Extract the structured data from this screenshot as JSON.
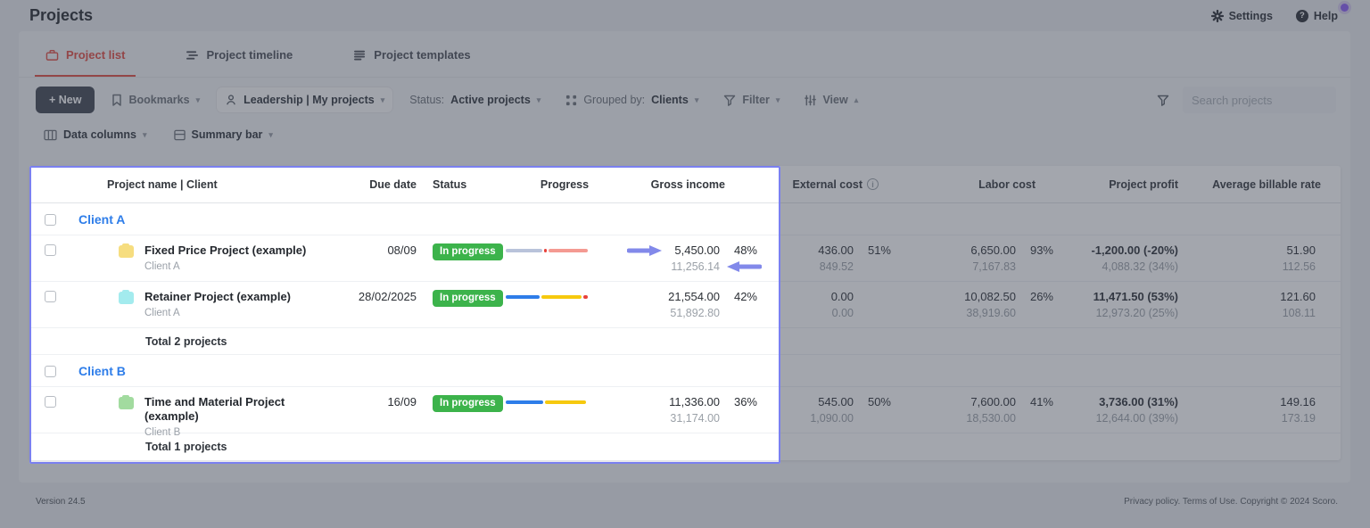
{
  "theme": {
    "accent_red": "#e14b41",
    "link_blue": "#2e7de9",
    "badge_green": "#3cb34b",
    "annotation": "#8289ea",
    "spotlight_border": "#7a80f0"
  },
  "header": {
    "title": "Projects",
    "settings": "Settings",
    "help": "Help"
  },
  "tabs": [
    {
      "label": "Project list"
    },
    {
      "label": "Project timeline"
    },
    {
      "label": "Project templates"
    }
  ],
  "toolbar": {
    "new_label": "+ New",
    "bookmarks_label": "Bookmarks",
    "scope_label": "Leadership | My projects",
    "status_prefix": "Status:",
    "status_value": "Active projects",
    "grouped_prefix": "Grouped by:",
    "grouped_value": "Clients",
    "filter_label": "Filter",
    "view_label": "View",
    "data_columns_label": "Data columns",
    "summary_bar_label": "Summary bar",
    "search_placeholder": "Search projects"
  },
  "table": {
    "columns": [
      "Project name | Client",
      "Due date",
      "Status",
      "Progress",
      "Gross income",
      "External cost",
      "Labor cost",
      "Project profit",
      "Average billable rate"
    ],
    "groups": [
      {
        "client": "Client A",
        "total_label": "Total 2 projects",
        "rows": [
          {
            "name": "Fixed Price Project (example)",
            "client": "Client A",
            "folder_color": "#f6dd7f",
            "due": "08/09",
            "status": "In progress",
            "progress": [
              [
                "#b9c3da",
                45
              ],
              [
                "#e8423b",
                4
              ],
              [
                "#f49a92",
                48
              ]
            ],
            "gross_main": "5,450.00",
            "gross_pct": "48%",
            "gross_sub": "11,256.14",
            "ext_main": "436.00",
            "ext_pct": "51%",
            "ext_sub": "849.52",
            "labor_main": "6,650.00",
            "labor_pct": "93%",
            "labor_sub": "7,167.83",
            "profit_main": "-1,200.00 (-20%)",
            "profit_sub": "4,088.32 (34%)",
            "rate_main": "51.90",
            "rate_sub": "112.56"
          },
          {
            "name": "Retainer Project (example)",
            "client": "Client A",
            "folder_color": "#a3ebee",
            "due": "28/02/2025",
            "status": "In progress",
            "progress": [
              [
                "#2e7de9",
                42
              ],
              [
                "#f6c90e",
                50
              ],
              [
                "#e8423b",
                5
              ]
            ],
            "gross_main": "21,554.00",
            "gross_pct": "42%",
            "gross_sub": "51,892.80",
            "ext_main": "0.00",
            "ext_pct": "",
            "ext_sub": "0.00",
            "labor_main": "10,082.50",
            "labor_pct": "26%",
            "labor_sub": "38,919.60",
            "profit_main": "11,471.50 (53%)",
            "profit_sub": "12,973.20 (25%)",
            "rate_main": "121.60",
            "rate_sub": "108.11"
          }
        ]
      },
      {
        "client": "Client B",
        "total_label": "Total 1 projects",
        "rows": [
          {
            "name": "Time and Material Project (example)",
            "client": "Client B",
            "folder_color": "#a2db9f",
            "due": "16/09",
            "status": "In progress",
            "progress": [
              [
                "#2e7de9",
                46
              ],
              [
                "#f6c90e",
                50
              ]
            ],
            "gross_main": "11,336.00",
            "gross_pct": "36%",
            "gross_sub": "31,174.00",
            "ext_main": "545.00",
            "ext_pct": "50%",
            "ext_sub": "1,090.00",
            "labor_main": "7,600.00",
            "labor_pct": "41%",
            "labor_sub": "18,530.00",
            "profit_main": "3,736.00 (31%)",
            "profit_sub": "12,644.00 (39%)",
            "rate_main": "149.16",
            "rate_sub": "173.19"
          }
        ]
      }
    ]
  },
  "footer": {
    "version": "Version 24.5",
    "legal": "Privacy policy. Terms of Use. Copyright © 2024 Scoro."
  }
}
